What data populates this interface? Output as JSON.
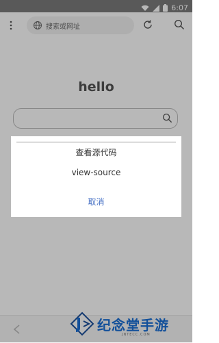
{
  "status_bar": {
    "time": "6:07",
    "icons": [
      "wifi-icon",
      "signal-icon",
      "battery-icon"
    ]
  },
  "toolbar": {
    "address_placeholder": "搜索或网址",
    "icons": [
      "more-vertical-icon",
      "globe-icon",
      "refresh-icon",
      "search-icon"
    ]
  },
  "page": {
    "heading": "hello",
    "search_icon": "search-icon"
  },
  "dialog": {
    "options": [
      "查看源代码",
      "view-source"
    ],
    "cancel_label": "取消"
  },
  "bottom_bar": {
    "icons": [
      "back-arrow-icon"
    ]
  },
  "watermark": {
    "text": "纪念堂手游",
    "subtext": "JNTECC.COM"
  },
  "colors": {
    "accent": "#4b74c6",
    "brand": "#1b6fd6",
    "overlay": "rgba(0,0,0,0.28)"
  }
}
